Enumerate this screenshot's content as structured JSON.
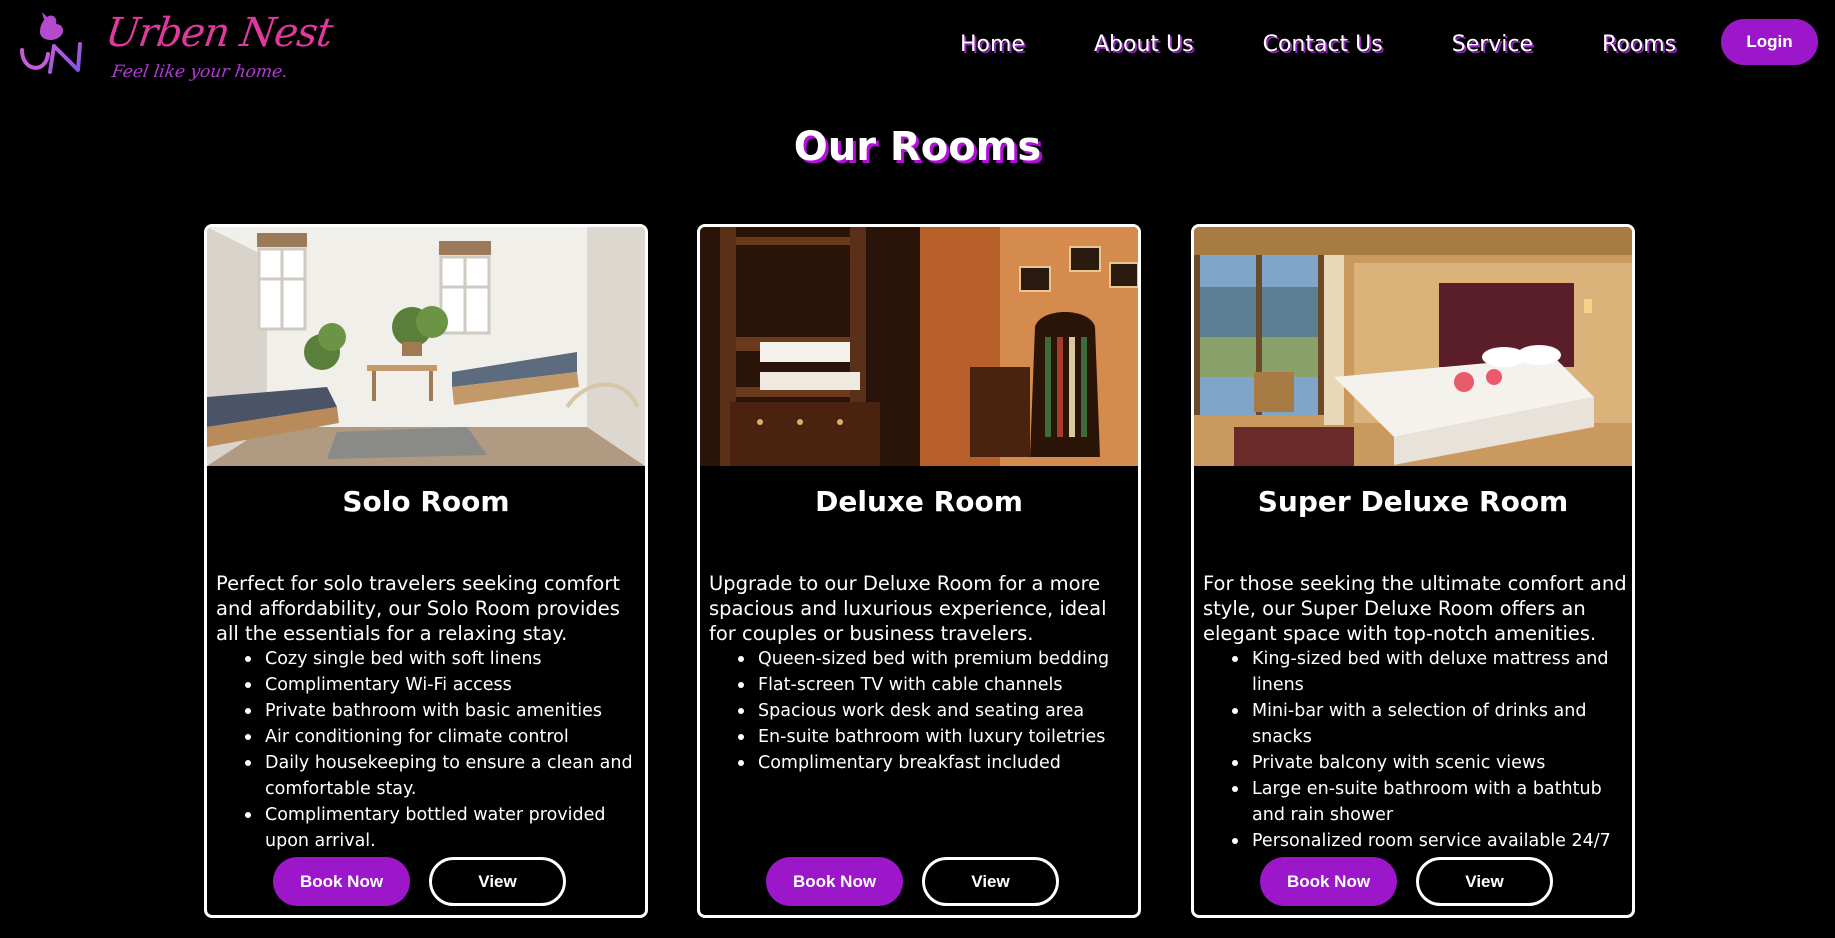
{
  "brand": {
    "name": "Urben Nest",
    "tagline": "Feel like your home."
  },
  "nav": {
    "items": [
      "Home",
      "About Us",
      "Contact Us",
      "Service",
      "Rooms"
    ],
    "login_label": "Login"
  },
  "page": {
    "title": "Our Rooms"
  },
  "colors": {
    "accent": "#9b17c9",
    "brand_pink": "#e0399e",
    "background": "#000000"
  },
  "rooms": [
    {
      "title": "Solo Room",
      "description": "Perfect for solo travelers seeking comfort and affordability, our Solo Room provides all the essentials for a relaxing stay.",
      "features": [
        "Cozy single bed with soft linens",
        "Complimentary Wi-Fi access",
        "Private bathroom with basic amenities",
        "Air conditioning for climate control",
        "Daily housekeeping to ensure a clean and comfortable stay.",
        "Complimentary bottled water provided upon arrival."
      ],
      "book_label": "Book Now",
      "view_label": "View"
    },
    {
      "title": "Deluxe Room",
      "description": "Upgrade to our Deluxe Room for a more spacious and luxurious experience, ideal for couples or business travelers.",
      "features": [
        "Queen-sized bed with premium bedding",
        "Flat-screen TV with cable channels",
        "Spacious work desk and seating area",
        "En-suite bathroom with luxury toiletries",
        "Complimentary breakfast included"
      ],
      "book_label": "Book Now",
      "view_label": "View"
    },
    {
      "title": "Super Deluxe Room",
      "description": "For those seeking the ultimate comfort and style, our Super Deluxe Room offers an elegant space with top-notch amenities.",
      "features": [
        "King-sized bed with deluxe mattress and linens",
        "Mini-bar with a selection of drinks and snacks",
        "Private balcony with scenic views",
        "Large en-suite bathroom with a bathtub and rain shower",
        "Personalized room service available 24/7"
      ],
      "book_label": "Book Now",
      "view_label": "View"
    }
  ]
}
